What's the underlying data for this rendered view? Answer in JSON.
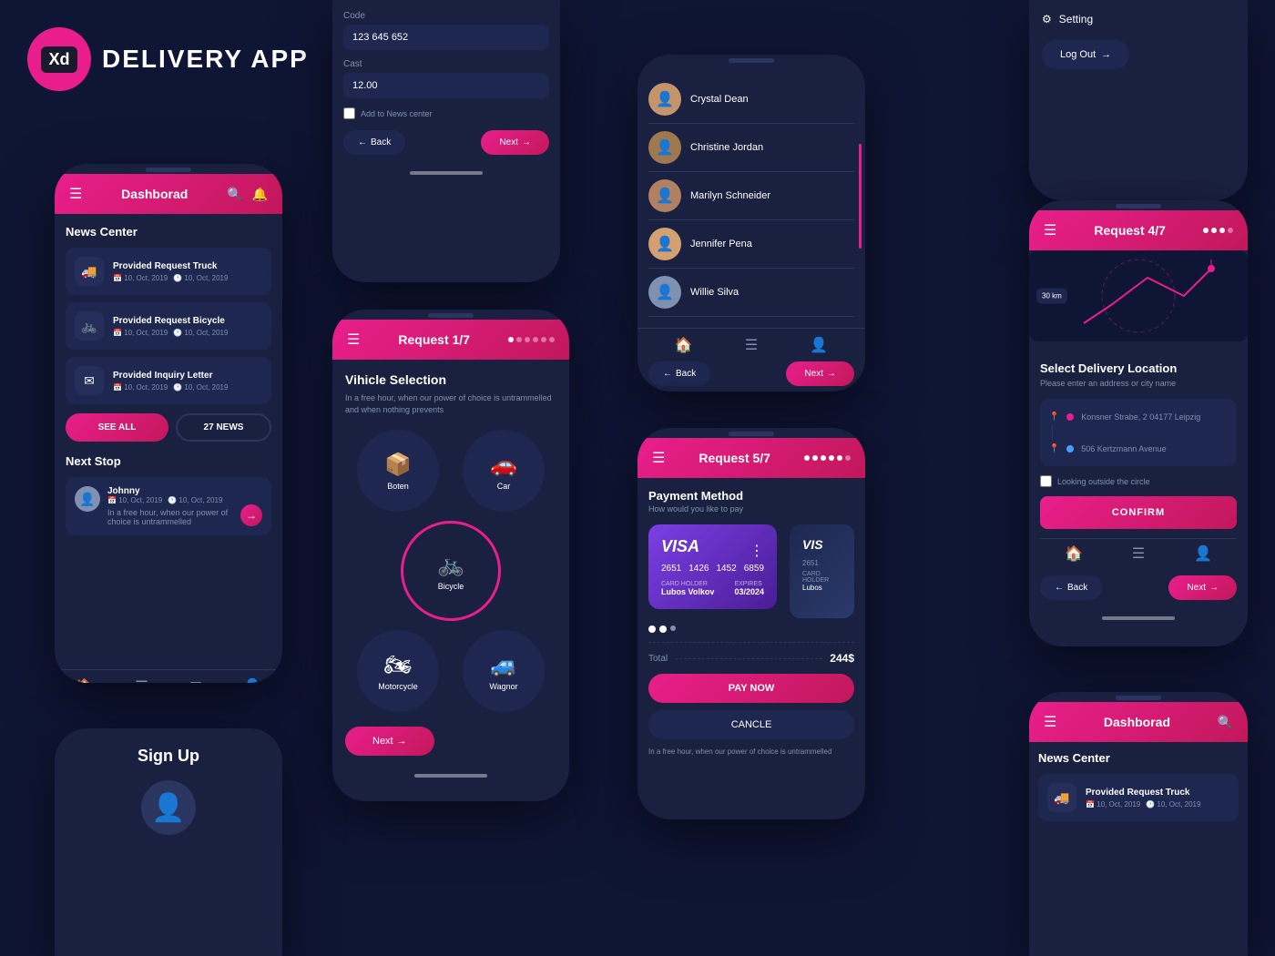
{
  "app": {
    "logo_text": "DELIVERY APP",
    "logo_xd": "Xd"
  },
  "phone1": {
    "header_title": "Dashborad",
    "news_center_title": "News Center",
    "news_items": [
      {
        "icon": "🚚",
        "title": "Provided Request Truck",
        "date1": "10, Oct, 2019",
        "date2": "10, Oct, 2019"
      },
      {
        "icon": "🚲",
        "title": "Provided Request Bicycle",
        "date1": "10, Oct, 2019",
        "date2": "10, Oct, 2019"
      },
      {
        "icon": "✉",
        "title": "Provided Inquiry Letter",
        "date1": "10, Oct, 2019",
        "date2": "10, Oct, 2019"
      }
    ],
    "btn_see_all": "SEE ALL",
    "btn_news": "27 NEWS",
    "next_stop_title": "Next Stop",
    "next_stop_name": "Johnny",
    "next_stop_date1": "10, Oct, 2019",
    "next_stop_date2": "10, Oct, 2019",
    "next_stop_text": "In a free hour, when our power of choice is untrammelled"
  },
  "phone2": {
    "code_label": "Code",
    "code_value": "123 645 652",
    "cost_label": "Cast",
    "cost_value": "12.00",
    "checkbox_label": "Add to News center",
    "btn_back": "Back",
    "btn_next": "Next"
  },
  "phone3": {
    "contacts": [
      {
        "name": "Crystal Dean"
      },
      {
        "name": "Christine Jordan"
      },
      {
        "name": "Marilyn Schneider"
      },
      {
        "name": "Jennifer Pena"
      },
      {
        "name": "Willie Silva"
      }
    ],
    "btn_back": "Back",
    "btn_next": "Next"
  },
  "phone4": {
    "setting_label": "Setting",
    "btn_logout": "Log Out"
  },
  "phone5": {
    "header_title": "Request 1/7",
    "request_title": "Vihicle Selection",
    "request_desc": "In a free hour, when our power of choice is untrammelled and when nothing prevents",
    "vehicles": [
      {
        "icon": "📦",
        "label": "Boten",
        "selected": false
      },
      {
        "icon": "🚗",
        "label": "Car",
        "selected": false
      },
      {
        "icon": "🚲",
        "label": "Bicycle",
        "selected": true
      },
      {
        "icon": "🏍",
        "label": "Motorcycle",
        "selected": false
      },
      {
        "icon": "🚙",
        "label": "Wagnor",
        "selected": false
      }
    ],
    "btn_next": "Next"
  },
  "phone6": {
    "header_title": "Request 5/7",
    "payment_title": "Payment Method",
    "payment_sub": "How would you like to pay",
    "visa_numbers": [
      "2651",
      "1426",
      "1452",
      "6859"
    ],
    "card_holder_label": "CARD HOLDER",
    "card_holder": "Lubos Volkov",
    "expires_label": "EXPIRES",
    "expires": "03/2024",
    "total_label": "Total",
    "total_amount": "244$",
    "btn_pay": "PAY NOW",
    "btn_cancel": "CANCLE"
  },
  "phone7": {
    "header_title": "Request 4/7",
    "delivery_title": "Select Delivery Location",
    "delivery_sub": "Please enter an address or city name",
    "route_from": "Konsner Strabe, 2 04177 Leipzig",
    "route_to": "506 Kertzmann Avenue",
    "km_label": "30 km",
    "checkbox_label": "Looking outside the circle",
    "btn_confirm": "CONFIRM",
    "btn_back": "Back",
    "btn_next": "Next"
  },
  "phone8": {
    "signup_title": "Sign Up"
  },
  "phone9": {
    "header_title": "Dashborad",
    "news_center_title": "News Center",
    "news_item_title": "Provided Request Truck",
    "news_item_date1": "10, Oct, 2019",
    "news_item_date2": "10, Oct, 2019"
  }
}
